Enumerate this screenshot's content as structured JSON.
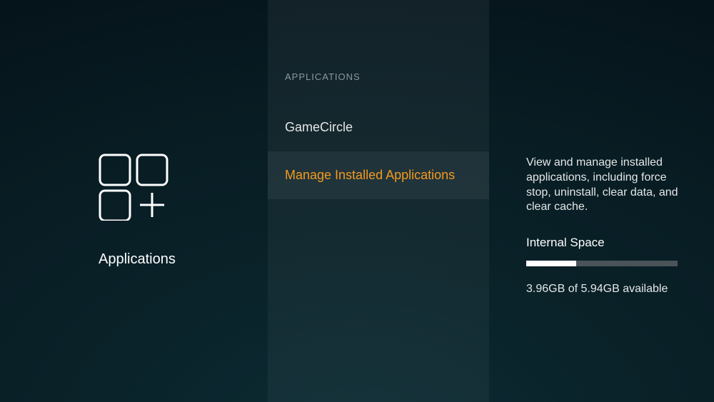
{
  "left": {
    "title": "Applications"
  },
  "mid": {
    "header": "APPLICATIONS",
    "items": [
      {
        "label": "GameCircle",
        "selected": false
      },
      {
        "label": "Manage Installed Applications",
        "selected": true
      }
    ]
  },
  "right": {
    "description": "View and manage installed applications, including force stop, uninstall, clear data, and clear cache.",
    "storage_label": "Internal Space",
    "storage_used_gb": 1.98,
    "storage_total_gb": 5.94,
    "storage_free_text": "3.96GB of 5.94GB available",
    "storage_percent_used": 33
  }
}
